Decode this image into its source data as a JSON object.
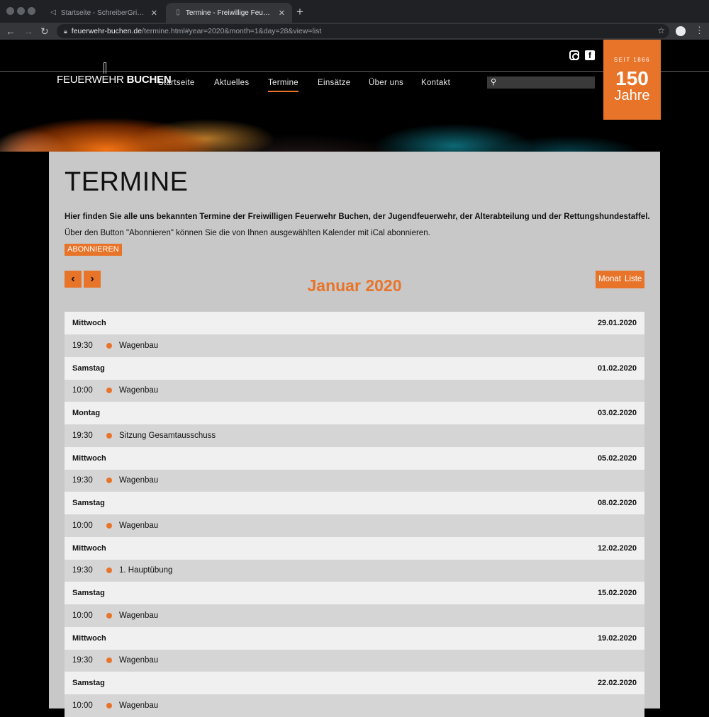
{
  "browser": {
    "tabs": [
      {
        "title": "Startseite - SchreiberGrimm . Wi",
        "active": false
      },
      {
        "title": "Termine - Freiwillige Feuerwehr B",
        "active": true
      }
    ],
    "url_host": "feuerwehr-buchen.de",
    "url_path": "/termine.html#year=2020&month=1&day=28&view=list"
  },
  "header": {
    "logo_light": "FEUERWEHR",
    "logo_bold": "BUCHEN",
    "nav": [
      "Startseite",
      "Aktuelles",
      "Termine",
      "Einsätze",
      "Über uns",
      "Kontakt"
    ],
    "nav_active": "Termine",
    "badge": {
      "seit": "SEIT 1866",
      "number": "150",
      "word": "Jahre"
    },
    "accent": "#e8742a"
  },
  "page": {
    "title": "TERMINE",
    "intro_bold": "Hier finden Sie alle uns bekannten Termine der Freiwilligen Feuerwehr Buchen, der Jugendfeuerwehr, der Alterabteilung und der Rettungshundestaffel.",
    "intro": "Über den Button \"Abonnieren\" können Sie die von Ihnen ausgewählten Kalender mit iCal abonnieren.",
    "subscribe_label": "ABONNIEREN",
    "prev_label": "‹",
    "next_label": "›",
    "month_label": "Januar 2020",
    "view_month": "Monat",
    "view_list": "Liste"
  },
  "events": [
    {
      "day": "Mittwoch",
      "date": "29.01.2020",
      "time": "19:30",
      "title": "Wagenbau"
    },
    {
      "day": "Samstag",
      "date": "01.02.2020",
      "time": "10:00",
      "title": "Wagenbau"
    },
    {
      "day": "Montag",
      "date": "03.02.2020",
      "time": "19:30",
      "title": "Sitzung Gesamtausschuss"
    },
    {
      "day": "Mittwoch",
      "date": "05.02.2020",
      "time": "19:30",
      "title": "Wagenbau"
    },
    {
      "day": "Samstag",
      "date": "08.02.2020",
      "time": "10:00",
      "title": "Wagenbau"
    },
    {
      "day": "Mittwoch",
      "date": "12.02.2020",
      "time": "19:30",
      "title": "1. Hauptübung"
    },
    {
      "day": "Samstag",
      "date": "15.02.2020",
      "time": "10:00",
      "title": "Wagenbau"
    },
    {
      "day": "Mittwoch",
      "date": "19.02.2020",
      "time": "19:30",
      "title": "Wagenbau"
    },
    {
      "day": "Samstag",
      "date": "22.02.2020",
      "time": "10:00",
      "title": "Wagenbau"
    }
  ]
}
